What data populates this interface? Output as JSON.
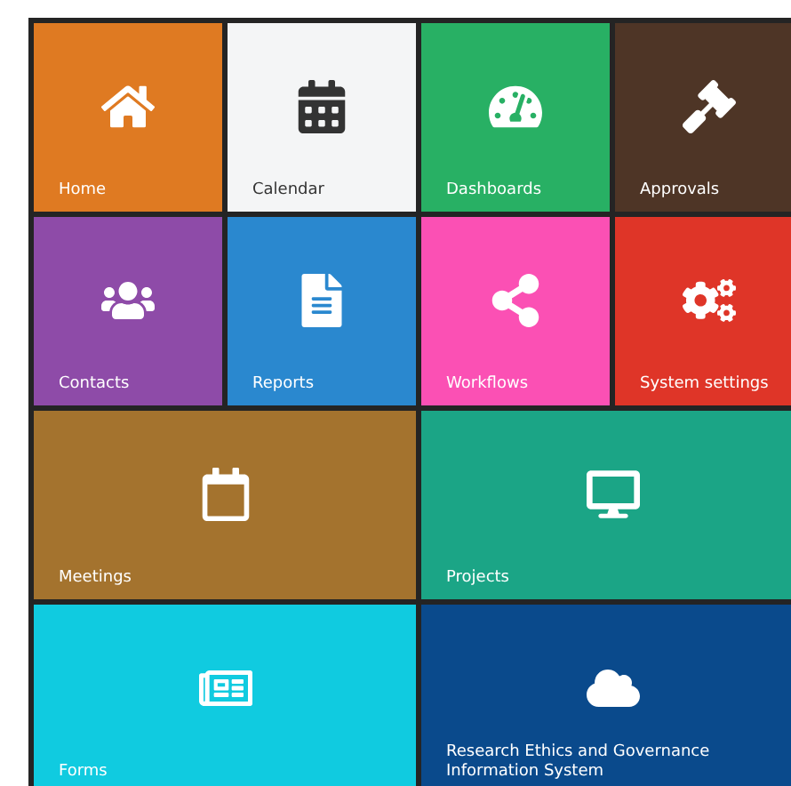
{
  "tiles": [
    {
      "label": "Home",
      "kind": "small",
      "color": "#df7a22"
    },
    {
      "label": "Calendar",
      "kind": "small",
      "color": "#f4f5f6"
    },
    {
      "label": "Dashboards",
      "kind": "small",
      "color": "#28b064"
    },
    {
      "label": "Approvals",
      "kind": "small",
      "color": "#4e3526"
    },
    {
      "label": "Contacts",
      "kind": "small",
      "color": "#8e4ba8"
    },
    {
      "label": "Reports",
      "kind": "small",
      "color": "#2a88cf"
    },
    {
      "label": "Workflows",
      "kind": "small",
      "color": "#fb50b4"
    },
    {
      "label": "System settings",
      "kind": "small",
      "color": "#df3528"
    },
    {
      "label": "Meetings",
      "kind": "wide",
      "color": "#a4732e"
    },
    {
      "label": "Projects",
      "kind": "wide",
      "color": "#1ba586"
    },
    {
      "label": "Forms",
      "kind": "wide",
      "color": "#10cbe0"
    },
    {
      "label": "Research Ethics and Governance Information System",
      "kind": "wide",
      "color": "#0a4a8c"
    }
  ]
}
